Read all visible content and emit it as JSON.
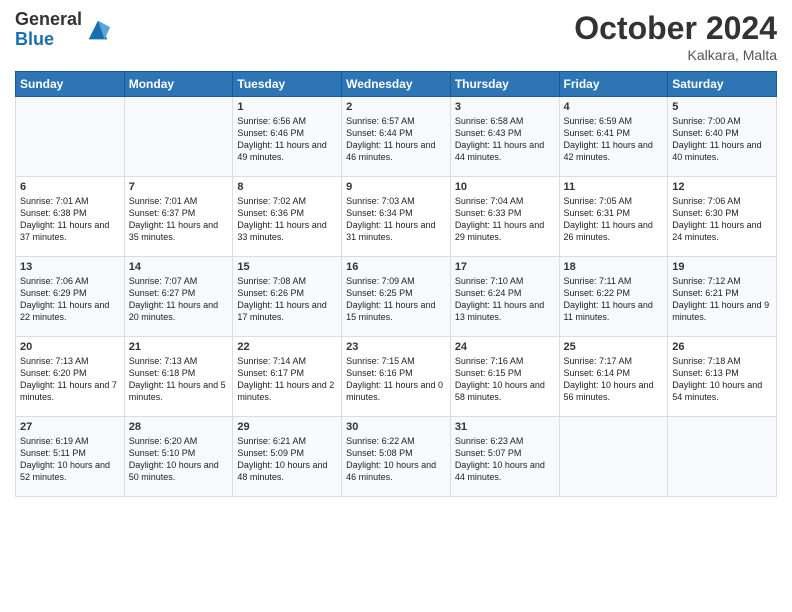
{
  "header": {
    "logo_line1": "General",
    "logo_line2": "Blue",
    "month_title": "October 2024",
    "location": "Kalkara, Malta"
  },
  "days_of_week": [
    "Sunday",
    "Monday",
    "Tuesday",
    "Wednesday",
    "Thursday",
    "Friday",
    "Saturday"
  ],
  "weeks": [
    [
      {
        "day": "",
        "info": ""
      },
      {
        "day": "",
        "info": ""
      },
      {
        "day": "1",
        "info": "Sunrise: 6:56 AM\nSunset: 6:46 PM\nDaylight: 11 hours and 49 minutes."
      },
      {
        "day": "2",
        "info": "Sunrise: 6:57 AM\nSunset: 6:44 PM\nDaylight: 11 hours and 46 minutes."
      },
      {
        "day": "3",
        "info": "Sunrise: 6:58 AM\nSunset: 6:43 PM\nDaylight: 11 hours and 44 minutes."
      },
      {
        "day": "4",
        "info": "Sunrise: 6:59 AM\nSunset: 6:41 PM\nDaylight: 11 hours and 42 minutes."
      },
      {
        "day": "5",
        "info": "Sunrise: 7:00 AM\nSunset: 6:40 PM\nDaylight: 11 hours and 40 minutes."
      }
    ],
    [
      {
        "day": "6",
        "info": "Sunrise: 7:01 AM\nSunset: 6:38 PM\nDaylight: 11 hours and 37 minutes."
      },
      {
        "day": "7",
        "info": "Sunrise: 7:01 AM\nSunset: 6:37 PM\nDaylight: 11 hours and 35 minutes."
      },
      {
        "day": "8",
        "info": "Sunrise: 7:02 AM\nSunset: 6:36 PM\nDaylight: 11 hours and 33 minutes."
      },
      {
        "day": "9",
        "info": "Sunrise: 7:03 AM\nSunset: 6:34 PM\nDaylight: 11 hours and 31 minutes."
      },
      {
        "day": "10",
        "info": "Sunrise: 7:04 AM\nSunset: 6:33 PM\nDaylight: 11 hours and 29 minutes."
      },
      {
        "day": "11",
        "info": "Sunrise: 7:05 AM\nSunset: 6:31 PM\nDaylight: 11 hours and 26 minutes."
      },
      {
        "day": "12",
        "info": "Sunrise: 7:06 AM\nSunset: 6:30 PM\nDaylight: 11 hours and 24 minutes."
      }
    ],
    [
      {
        "day": "13",
        "info": "Sunrise: 7:06 AM\nSunset: 6:29 PM\nDaylight: 11 hours and 22 minutes."
      },
      {
        "day": "14",
        "info": "Sunrise: 7:07 AM\nSunset: 6:27 PM\nDaylight: 11 hours and 20 minutes."
      },
      {
        "day": "15",
        "info": "Sunrise: 7:08 AM\nSunset: 6:26 PM\nDaylight: 11 hours and 17 minutes."
      },
      {
        "day": "16",
        "info": "Sunrise: 7:09 AM\nSunset: 6:25 PM\nDaylight: 11 hours and 15 minutes."
      },
      {
        "day": "17",
        "info": "Sunrise: 7:10 AM\nSunset: 6:24 PM\nDaylight: 11 hours and 13 minutes."
      },
      {
        "day": "18",
        "info": "Sunrise: 7:11 AM\nSunset: 6:22 PM\nDaylight: 11 hours and 11 minutes."
      },
      {
        "day": "19",
        "info": "Sunrise: 7:12 AM\nSunset: 6:21 PM\nDaylight: 11 hours and 9 minutes."
      }
    ],
    [
      {
        "day": "20",
        "info": "Sunrise: 7:13 AM\nSunset: 6:20 PM\nDaylight: 11 hours and 7 minutes."
      },
      {
        "day": "21",
        "info": "Sunrise: 7:13 AM\nSunset: 6:18 PM\nDaylight: 11 hours and 5 minutes."
      },
      {
        "day": "22",
        "info": "Sunrise: 7:14 AM\nSunset: 6:17 PM\nDaylight: 11 hours and 2 minutes."
      },
      {
        "day": "23",
        "info": "Sunrise: 7:15 AM\nSunset: 6:16 PM\nDaylight: 11 hours and 0 minutes."
      },
      {
        "day": "24",
        "info": "Sunrise: 7:16 AM\nSunset: 6:15 PM\nDaylight: 10 hours and 58 minutes."
      },
      {
        "day": "25",
        "info": "Sunrise: 7:17 AM\nSunset: 6:14 PM\nDaylight: 10 hours and 56 minutes."
      },
      {
        "day": "26",
        "info": "Sunrise: 7:18 AM\nSunset: 6:13 PM\nDaylight: 10 hours and 54 minutes."
      }
    ],
    [
      {
        "day": "27",
        "info": "Sunrise: 6:19 AM\nSunset: 5:11 PM\nDaylight: 10 hours and 52 minutes."
      },
      {
        "day": "28",
        "info": "Sunrise: 6:20 AM\nSunset: 5:10 PM\nDaylight: 10 hours and 50 minutes."
      },
      {
        "day": "29",
        "info": "Sunrise: 6:21 AM\nSunset: 5:09 PM\nDaylight: 10 hours and 48 minutes."
      },
      {
        "day": "30",
        "info": "Sunrise: 6:22 AM\nSunset: 5:08 PM\nDaylight: 10 hours and 46 minutes."
      },
      {
        "day": "31",
        "info": "Sunrise: 6:23 AM\nSunset: 5:07 PM\nDaylight: 10 hours and 44 minutes."
      },
      {
        "day": "",
        "info": ""
      },
      {
        "day": "",
        "info": ""
      }
    ]
  ]
}
